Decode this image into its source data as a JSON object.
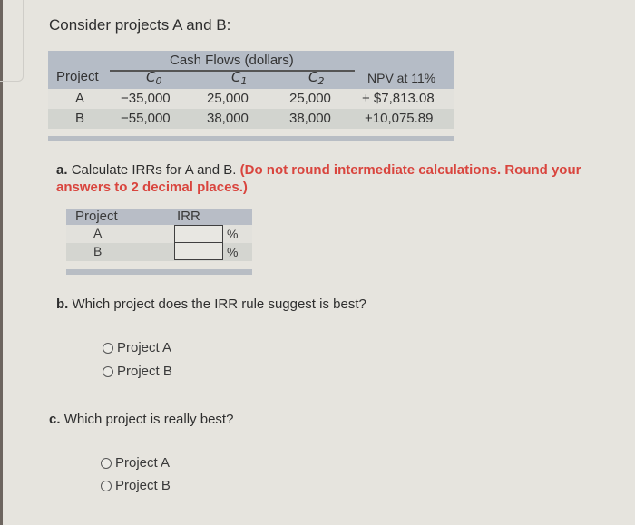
{
  "intro": "Consider projects A and B:",
  "cash_flow_table": {
    "super_header": "Cash Flows (dollars)",
    "headers": {
      "project": "Project",
      "c0": {
        "base": "C",
        "sub": "0"
      },
      "c1": {
        "base": "C",
        "sub": "1"
      },
      "c2": {
        "base": "C",
        "sub": "2"
      },
      "npv": "NPV at 11%"
    },
    "rows": [
      {
        "project": "A",
        "c0": "−35,000",
        "c1": "25,000",
        "c2": "25,000",
        "npv": "+ $7,813.08"
      },
      {
        "project": "B",
        "c0": "−55,000",
        "c1": "38,000",
        "c2": "38,000",
        "npv": "+10,075.89"
      }
    ]
  },
  "question_a": {
    "letter": "a.",
    "text": "Calculate IRRs for A and B.",
    "instruction": "(Do not round intermediate calculations. Round your answers to 2 decimal places.)"
  },
  "irr_table": {
    "headers": {
      "project": "Project",
      "irr": "IRR"
    },
    "rows": [
      {
        "project": "A",
        "value": "",
        "unit": "%"
      },
      {
        "project": "B",
        "value": "",
        "unit": "%"
      }
    ]
  },
  "question_b": {
    "letter": "b.",
    "text": "Which project does the IRR rule suggest is best?",
    "options": [
      "Project A",
      "Project B"
    ]
  },
  "question_c": {
    "letter": "c.",
    "text": "Which project is really best?",
    "options": [
      "Project A",
      "Project B"
    ]
  }
}
